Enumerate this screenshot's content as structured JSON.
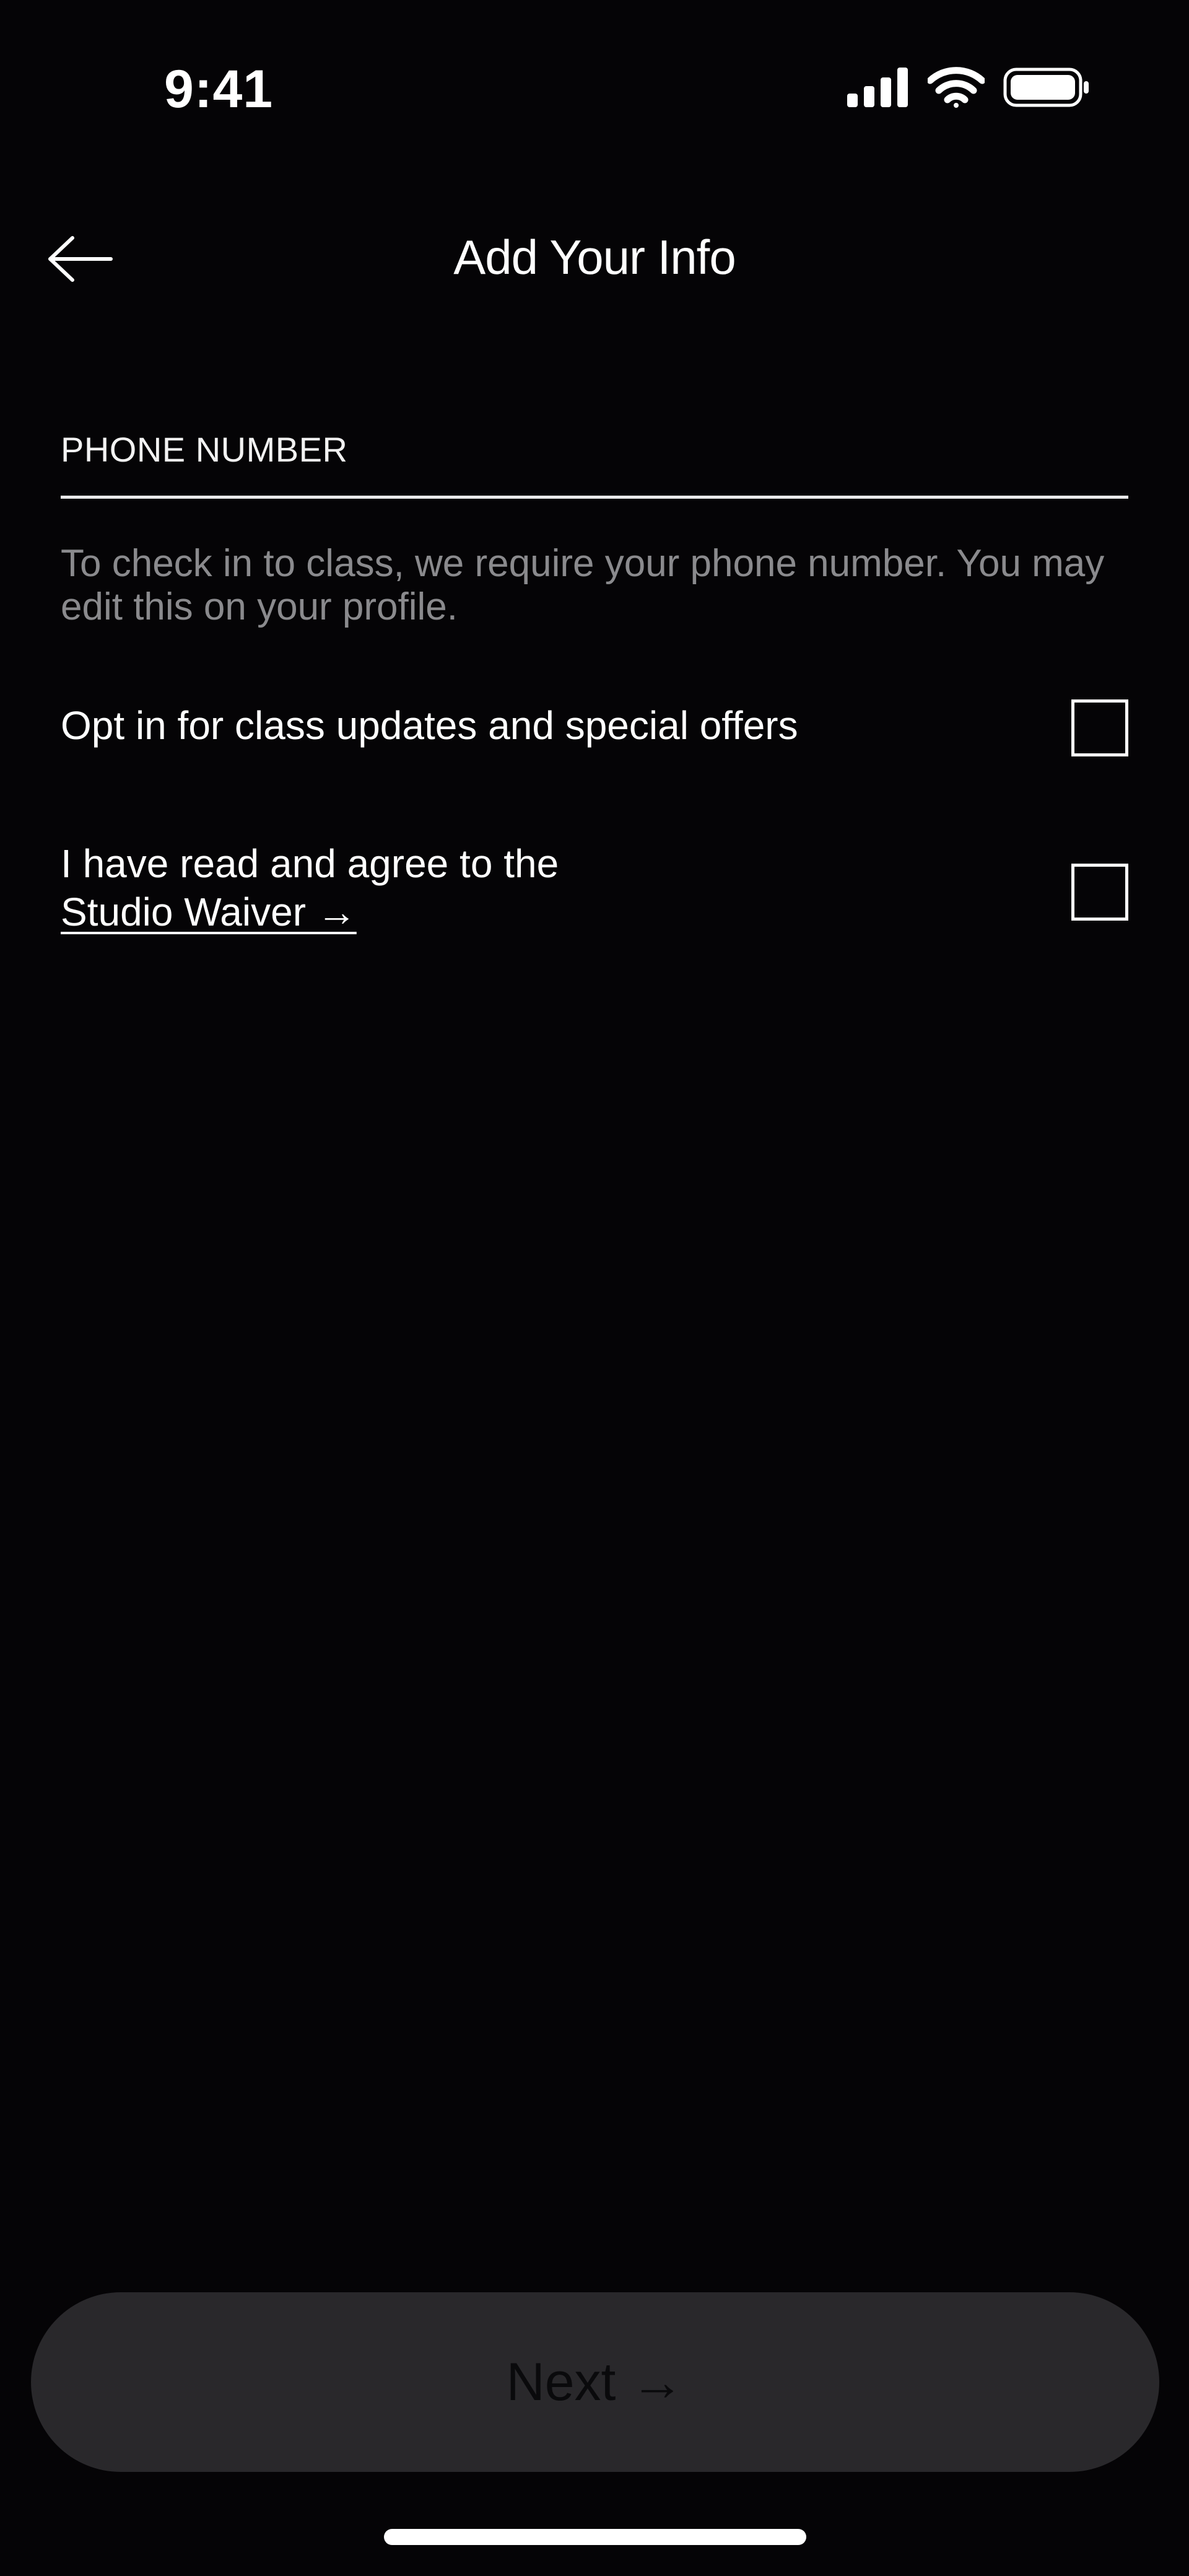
{
  "status_bar": {
    "time": "9:41",
    "icons": [
      "signal-icon",
      "wifi-icon",
      "battery-icon"
    ]
  },
  "header": {
    "title": "Add Your Info",
    "back_icon": "arrow-left-icon"
  },
  "phone_field": {
    "placeholder": "PHONE NUMBER",
    "value": ""
  },
  "helper_text": "To check in to class, we require your phone number. You may edit this on your profile.",
  "options": {
    "updates": {
      "label": "Opt in for class updates and special offers",
      "checked": false
    },
    "waiver": {
      "label": "I have read and agree to the",
      "link": "Studio Waiver →",
      "checked": false
    }
  },
  "footer": {
    "next_label": "Next →"
  },
  "colors": {
    "background": "#050406",
    "text": "#ffffff",
    "muted": "#8a8a8d",
    "button_bg": "#29282b",
    "button_text": "#0a0a0c"
  }
}
